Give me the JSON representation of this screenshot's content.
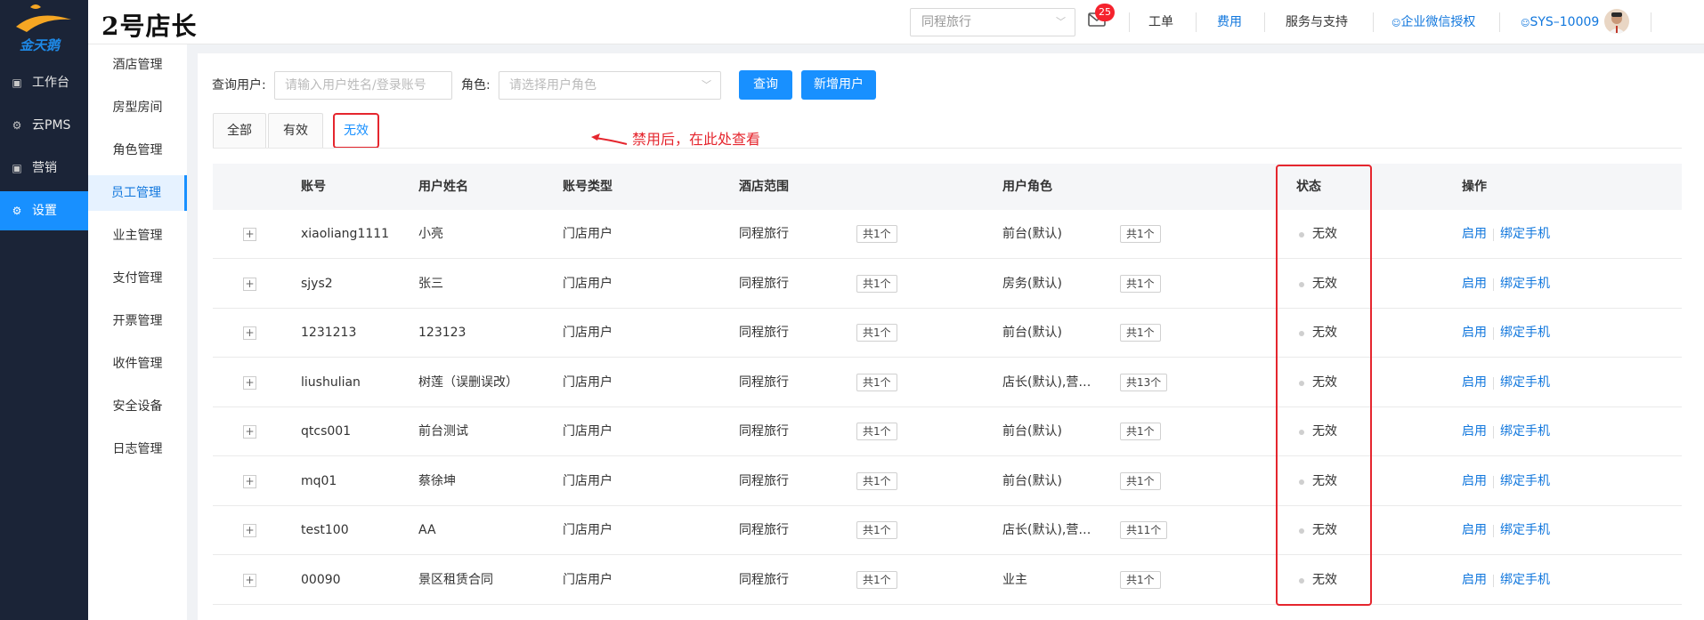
{
  "brand": {
    "logo_text": "金天鹅",
    "title": "2号店长"
  },
  "header": {
    "hotel_select": "同程旅行",
    "mail_badge": "25",
    "nav": [
      "工单",
      "费用",
      "服务与支持",
      "企业微信授权",
      "SYS–10009"
    ]
  },
  "sidebar": {
    "items": [
      {
        "label": "工作台",
        "icon": "workbench-icon"
      },
      {
        "label": "云PMS",
        "icon": "gear-icon"
      },
      {
        "label": "营销",
        "icon": "marketing-icon"
      },
      {
        "label": "设置",
        "icon": "gear-icon",
        "active": true
      }
    ]
  },
  "subnav": {
    "items": [
      "酒店管理",
      "房型房间",
      "角色管理",
      "员工管理",
      "业主管理",
      "支付管理",
      "开票管理",
      "收件管理",
      "安全设备",
      "日志管理"
    ],
    "active": "员工管理"
  },
  "filters": {
    "user_label": "查询用户:",
    "user_placeholder": "请输入用户姓名/登录账号",
    "role_label": "角色:",
    "role_placeholder": "请选择用户角色",
    "query_button": "查询",
    "add_button": "新增用户"
  },
  "tabs": [
    "全部",
    "有效",
    "无效"
  ],
  "active_tab": "无效",
  "annotation": "禁用后，在此处查看",
  "table": {
    "headers": [
      "账号",
      "用户姓名",
      "账号类型",
      "酒店范围",
      "用户角色",
      "状态",
      "操作"
    ],
    "rows": [
      {
        "account": "xiaoliang1111",
        "name": "小亮",
        "type": "门店用户",
        "hotel": "同程旅行",
        "hotel_count": "共1个",
        "role": "前台(默认)",
        "role_count": "共1个",
        "status": "无效",
        "actions": [
          "启用",
          "绑定手机"
        ]
      },
      {
        "account": "sjys2",
        "name": "张三",
        "type": "门店用户",
        "hotel": "同程旅行",
        "hotel_count": "共1个",
        "role": "房务(默认)",
        "role_count": "共1个",
        "status": "无效",
        "actions": [
          "启用",
          "绑定手机"
        ]
      },
      {
        "account": "1231213",
        "name": "123123",
        "type": "门店用户",
        "hotel": "同程旅行",
        "hotel_count": "共1个",
        "role": "前台(默认)",
        "role_count": "共1个",
        "status": "无效",
        "actions": [
          "启用",
          "绑定手机"
        ]
      },
      {
        "account": "liushulian",
        "name": "树莲（误删误改）",
        "type": "门店用户",
        "hotel": "同程旅行",
        "hotel_count": "共1个",
        "role": "店长(默认),营…",
        "role_count": "共13个",
        "status": "无效",
        "actions": [
          "启用",
          "绑定手机"
        ]
      },
      {
        "account": "qtcs001",
        "name": "前台测试",
        "type": "门店用户",
        "hotel": "同程旅行",
        "hotel_count": "共1个",
        "role": "前台(默认)",
        "role_count": "共1个",
        "status": "无效",
        "actions": [
          "启用",
          "绑定手机"
        ]
      },
      {
        "account": "mq01",
        "name": "蔡徐坤",
        "type": "门店用户",
        "hotel": "同程旅行",
        "hotel_count": "共1个",
        "role": "前台(默认)",
        "role_count": "共1个",
        "status": "无效",
        "actions": [
          "启用",
          "绑定手机"
        ]
      },
      {
        "account": "test100",
        "name": "AA",
        "type": "门店用户",
        "hotel": "同程旅行",
        "hotel_count": "共1个",
        "role": "店长(默认),营…",
        "role_count": "共11个",
        "status": "无效",
        "actions": [
          "启用",
          "绑定手机"
        ]
      },
      {
        "account": "00090",
        "name": "景区租赁合同",
        "type": "门店用户",
        "hotel": "同程旅行",
        "hotel_count": "共1个",
        "role": "业主",
        "role_count": "共1个",
        "status": "无效",
        "actions": [
          "启用",
          "绑定手机"
        ]
      }
    ]
  },
  "colors": {
    "primary": "#1890ff",
    "sidebar_bg": "#1b2437",
    "highlight_red": "#e5262e"
  }
}
